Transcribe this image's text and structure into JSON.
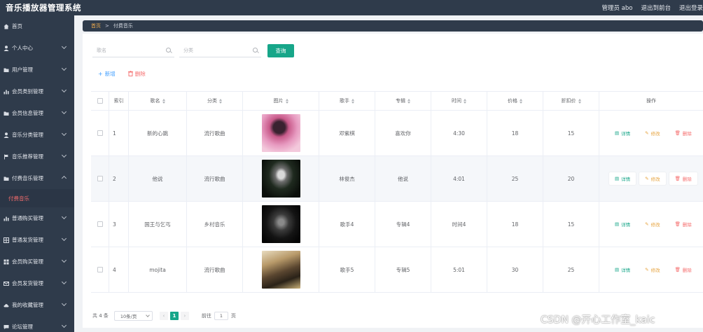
{
  "app": {
    "title": "音乐播放器管理系统"
  },
  "topbar": {
    "admin": "管理员 abo",
    "to_front": "退出到前台",
    "logout": "退出登录"
  },
  "sidebar": {
    "items": [
      {
        "label": "首页",
        "icon": "home-icon"
      },
      {
        "label": "个人中心",
        "icon": "user-icon"
      },
      {
        "label": "用户管理",
        "icon": "folder-icon"
      },
      {
        "label": "会员类别管理",
        "icon": "chart-icon"
      },
      {
        "label": "会员信息管理",
        "icon": "folder-icon"
      },
      {
        "label": "音乐分类管理",
        "icon": "user-icon"
      },
      {
        "label": "音乐推荐管理",
        "icon": "flag-icon"
      },
      {
        "label": "付费音乐管理",
        "icon": "folder-icon",
        "expanded": true
      }
    ],
    "sub_active": "付费音乐",
    "items_after": [
      {
        "label": "普通购买管理",
        "icon": "chart-icon"
      },
      {
        "label": "普通发货管理",
        "icon": "grid-icon"
      },
      {
        "label": "会员购买管理",
        "icon": "apps-icon"
      },
      {
        "label": "会员发货管理",
        "icon": "mail-icon"
      },
      {
        "label": "我的收藏管理",
        "icon": "cloud-icon"
      },
      {
        "label": "论坛管理",
        "icon": "chat-icon"
      }
    ]
  },
  "breadcrumb": {
    "home": "首页",
    "sep": ">",
    "current": "付费音乐"
  },
  "search": {
    "song_placeholder": "歌名",
    "category_placeholder": "分类",
    "query_label": "查询"
  },
  "actions": {
    "add_label": "新增",
    "delete_label": "删除"
  },
  "table": {
    "headers": [
      "索引",
      "歌名",
      "分类",
      "图片",
      "歌手",
      "专辑",
      "时间",
      "价格",
      "折扣价",
      "操作"
    ],
    "rows": [
      {
        "index": "1",
        "name": "新的心跳",
        "category": "流行歌曲",
        "singer": "邓紫棋",
        "album": "喜欢你",
        "time": "4:30",
        "price": "18",
        "discount": "15",
        "cover_color": "pink"
      },
      {
        "index": "2",
        "name": "他说",
        "category": "流行歌曲",
        "singer": "林俊杰",
        "album": "他说",
        "time": "4:01",
        "price": "25",
        "discount": "20",
        "cover_color": "dark"
      },
      {
        "index": "3",
        "name": "国王与乞丐",
        "category": "乡村音乐",
        "singer": "歌手4",
        "album": "专辑4",
        "time": "时间4",
        "price": "18",
        "discount": "15",
        "cover_color": "dark"
      },
      {
        "index": "4",
        "name": "mojita",
        "category": "流行歌曲",
        "singer": "歌手5",
        "album": "专辑5",
        "time": "5:01",
        "price": "30",
        "discount": "25",
        "cover_color": "sepia"
      }
    ],
    "op_detail": "详情",
    "op_modify": "修改",
    "op_delete": "删除"
  },
  "pager": {
    "total": "共 4 条",
    "size": "10条/页",
    "page": "1",
    "goto": "前往",
    "goto_value": "1",
    "page_unit": "页"
  },
  "watermark": "CSDN @开心工作室_kaic",
  "colors": {
    "sidebar": "#2f3b4b",
    "accent": "#17a689",
    "danger": "#f56c6c",
    "warning": "#e6a23c",
    "primary": "#409eff"
  }
}
